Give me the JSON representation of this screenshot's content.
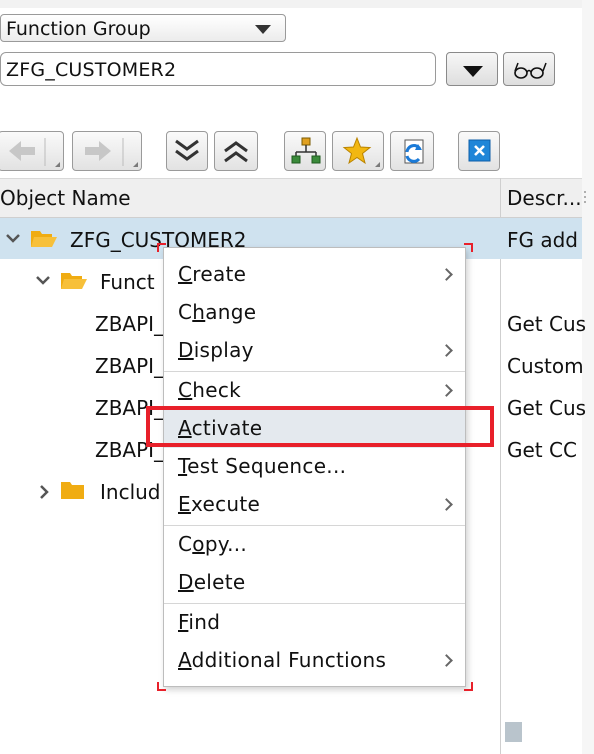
{
  "object_type": {
    "selected": "Function Group"
  },
  "object_name_input": {
    "value": "ZFG_CUSTOMER2"
  },
  "toolbar": {
    "buttons": [
      "back-icon",
      "forward-icon",
      "expand-all-icon",
      "collapse-all-icon",
      "hierarchy-icon",
      "favorites-star-icon",
      "refresh-icon",
      "close-x-icon"
    ]
  },
  "table": {
    "columns": {
      "name": "Object Name",
      "desc": "Descr..."
    },
    "rows": [
      {
        "name": "ZFG_CUSTOMER2",
        "desc": "FG add"
      },
      {
        "name": "Funct",
        "desc": ""
      },
      {
        "name": "ZBAPI_",
        "desc": "Get Cus"
      },
      {
        "name": "ZBAPI_",
        "desc": "Custom"
      },
      {
        "name": "ZBAPI_",
        "desc": "Get Cus"
      },
      {
        "name": "ZBAPI_",
        "desc": "Get CC"
      },
      {
        "name": "Includ",
        "desc": ""
      }
    ]
  },
  "context_menu": {
    "items": [
      {
        "pre": "",
        "ul": "C",
        "post": "reate",
        "submenu": true
      },
      {
        "pre": "C",
        "ul": "h",
        "post": "ange",
        "submenu": false
      },
      {
        "pre": "",
        "ul": "D",
        "post": "isplay",
        "submenu": true
      },
      {
        "pre": "",
        "ul": "C",
        "post": "heck",
        "submenu": true
      },
      {
        "pre": "",
        "ul": "A",
        "post": "ctivate",
        "submenu": false
      },
      {
        "pre": "",
        "ul": "T",
        "post": "est Sequence...",
        "submenu": false
      },
      {
        "pre": "",
        "ul": "E",
        "post": "xecute",
        "submenu": true
      },
      {
        "pre": "C",
        "ul": "o",
        "post": "py...",
        "submenu": false
      },
      {
        "pre": "",
        "ul": "D",
        "post": "elete",
        "submenu": false
      },
      {
        "pre": "",
        "ul": "F",
        "post": "ind",
        "submenu": false
      },
      {
        "pre": "",
        "ul": "A",
        "post": "dditional Functions",
        "submenu": true
      }
    ]
  },
  "colors": {
    "selection": "#cfe2ef",
    "highlight_box": "#e8202a",
    "folder": "#f0ac12",
    "menu_hover": "#e4e9ee"
  }
}
